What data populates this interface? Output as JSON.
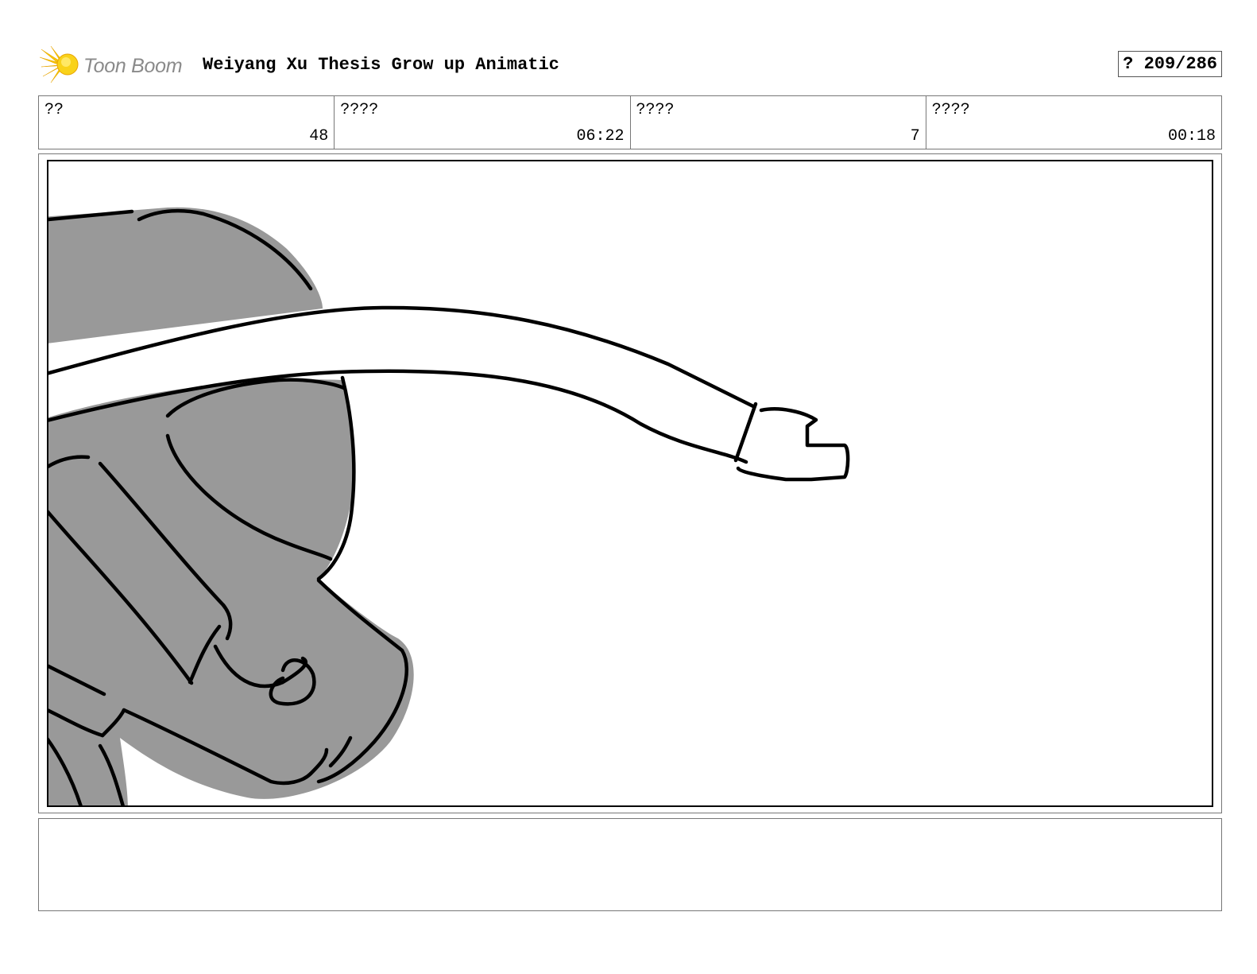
{
  "header": {
    "logo_text": "Toon Boom",
    "title": "Weiyang Xu Thesis Grow up Animatic",
    "page_counter": "? 209/286"
  },
  "info": [
    {
      "label": "??",
      "value": "48"
    },
    {
      "label": "????",
      "value": "06:22"
    },
    {
      "label": "????",
      "value": "7"
    },
    {
      "label": "????",
      "value": "00:18"
    }
  ],
  "panel": {
    "image": "storyboard-sketch",
    "colors": {
      "fill": "#999999",
      "ink": "#000000"
    }
  },
  "notes": ""
}
